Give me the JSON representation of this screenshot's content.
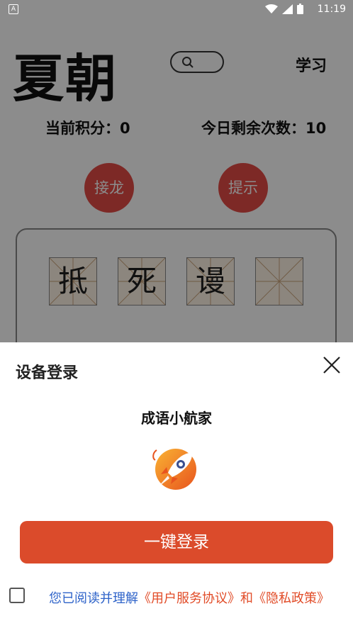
{
  "status_bar": {
    "time": "11:19",
    "left_icon": "A"
  },
  "header": {
    "title": "夏朝",
    "learn_label": "学习"
  },
  "stats": {
    "score_text": "当前积分：0",
    "remaining_text": "今日剩余次数：10"
  },
  "actions": {
    "solitaire_label": "接龙",
    "hint_label": "提示"
  },
  "board": {
    "chars": [
      "抵",
      "死",
      "谩",
      ""
    ]
  },
  "login_sheet": {
    "title": "设备登录",
    "app_name": "成语小航家",
    "login_button": "一键登录",
    "agreement_prefix": "您已阅读并理解",
    "user_agreement": "《用户服务协议》",
    "and_text": "和",
    "privacy_policy": "《隐私政策》"
  },
  "colors": {
    "accent": "#db4b2b",
    "link_blue": "#2e63c9",
    "button_red": "#e34b46"
  },
  "icons": [
    "search-icon",
    "close-icon",
    "rocket-logo-icon",
    "wifi-icon",
    "signal-icon",
    "battery-icon"
  ]
}
